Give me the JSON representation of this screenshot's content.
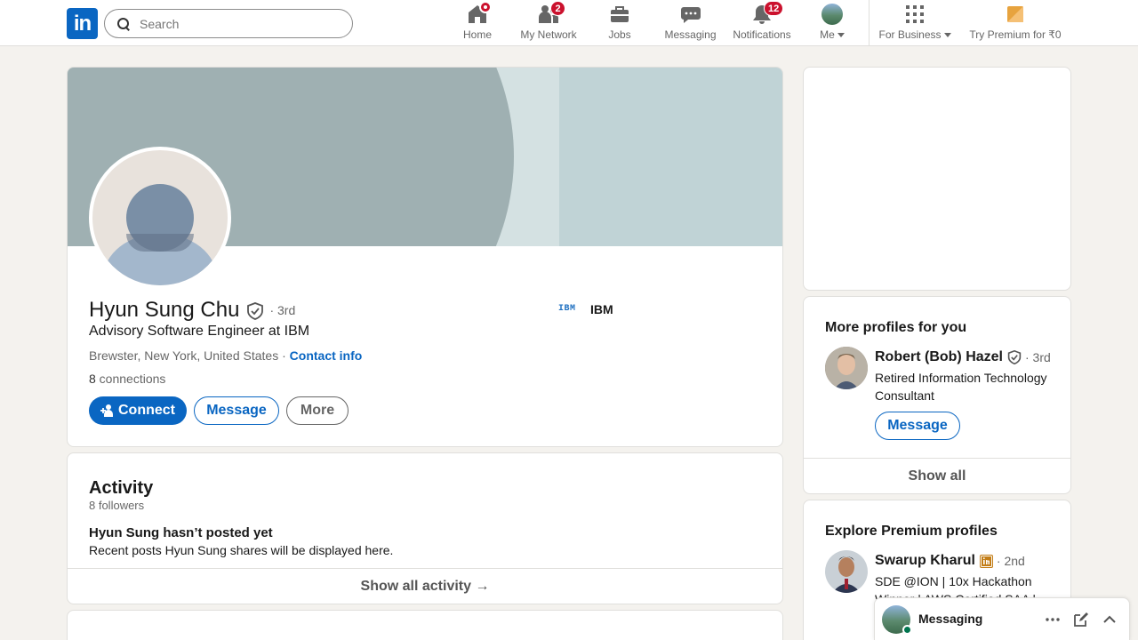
{
  "nav": {
    "logo": "in",
    "search_placeholder": "Search",
    "items": [
      {
        "label": "Home",
        "badge": ""
      },
      {
        "label": "My Network",
        "badge": "2"
      },
      {
        "label": "Jobs",
        "badge": ""
      },
      {
        "label": "Messaging",
        "badge": ""
      },
      {
        "label": "Notifications",
        "badge": "12"
      },
      {
        "label": "Me",
        "badge": ""
      },
      {
        "label": "For Business",
        "badge": ""
      },
      {
        "label": "Try Premium for ₹0",
        "badge": ""
      }
    ]
  },
  "profile": {
    "name": "Hyun Sung Chu",
    "degree": "· 3rd",
    "headline": "Advisory Software Engineer at IBM",
    "location": "Brewster, New York, United States",
    "location_sep": " · ",
    "contact_info": "Contact info",
    "connections_count": "8",
    "connections_label": " connections",
    "company_logo_text": "IBM",
    "company_name": "IBM",
    "buttons": {
      "connect": "Connect",
      "message": "Message",
      "more": "More"
    }
  },
  "activity": {
    "title": "Activity",
    "followers": "8 followers",
    "empty_title": "Hyun Sung hasn’t posted yet",
    "empty_sub": "Recent posts Hyun Sung shares will be displayed here.",
    "show_all": "Show all activity →"
  },
  "more_profiles": {
    "title": "More profiles for you",
    "person": {
      "name": "Robert (Bob) Hazel",
      "degree": "· 3rd",
      "headline": "Retired Information Technology Consultant",
      "button": "Message"
    },
    "show_all": "Show all"
  },
  "premium_profiles": {
    "title": "Explore Premium profiles",
    "person": {
      "name": "Swarup Kharul",
      "degree": "· 2nd",
      "headline_line1": "SDE @ION | 10x Hackathon",
      "headline_line2": "Winner | AWS Certified SAA |"
    }
  },
  "messaging_bar": {
    "label": "Messaging"
  },
  "colors": {
    "brand": "#0a66c2",
    "badge": "#cb112d",
    "background": "#f4f2ee"
  }
}
